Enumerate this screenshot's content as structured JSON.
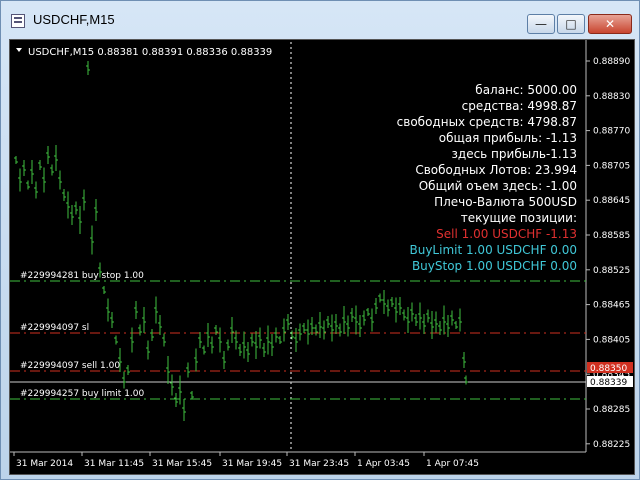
{
  "window": {
    "title": "USDCHF,M15",
    "buttons": {
      "minimize": "—",
      "maximize": "□",
      "close": "✕"
    }
  },
  "chart": {
    "header_label": "USDCHF,M15  0.88381 0.88391 0.88336 0.88339",
    "price_axis": [
      "0.88890",
      "0.88830",
      "0.88770",
      "0.88705",
      "0.88645",
      "0.88585",
      "0.88525",
      "0.88465",
      "0.88405",
      "0.88345",
      "0.88285",
      "0.88225"
    ],
    "time_axis": [
      "31 Mar 2014",
      "31 Mar 11:45",
      "31 Mar 15:45",
      "31 Mar 19:45",
      "31 Mar 23:45",
      "1 Apr 03:45",
      "1 Apr 07:45"
    ],
    "price_tags": {
      "red": "0.88350",
      "white": "0.88339"
    },
    "order_lines": [
      {
        "label": "#229994281 buy stop 1.00",
        "color": "#3fbf3f"
      },
      {
        "label": "#229994097 sl",
        "color": "#d03020"
      },
      {
        "label": "#229994097 sell 1.00",
        "color": "#d03020"
      },
      {
        "label": "#229994257 buy limit 1.00",
        "color": "#3fbf3f"
      }
    ],
    "info_panel": [
      {
        "text": "баланс: 5000.00",
        "color": "#ffffff"
      },
      {
        "text": "средства: 4998.87",
        "color": "#ffffff"
      },
      {
        "text": "свободных средств: 4798.87",
        "color": "#ffffff"
      },
      {
        "text": "общая прибыль: -1.13",
        "color": "#ffffff"
      },
      {
        "text": "здесь прибыль-1.13",
        "color": "#ffffff"
      },
      {
        "text": "Свободных Лотов: 23.994",
        "color": "#ffffff"
      },
      {
        "text": "Общий оъем здесь: -1.00",
        "color": "#ffffff"
      },
      {
        "text": "Плечо-Валюта 500USD",
        "color": "#ffffff"
      },
      {
        "text": "текущие позиции:",
        "color": "#ffffff"
      },
      {
        "text": "Sell 1.00 USDCHF -1.13",
        "color": "#e03030"
      },
      {
        "text": "BuyLimit 1.00 USDCHF 0.00",
        "color": "#40c8d8"
      },
      {
        "text": "BuyStop 1.00 USDCHF 0.00",
        "color": "#40c8d8"
      }
    ]
  },
  "colors": {
    "background": "#000000",
    "bars": "#3fbf3f",
    "text": "#ffffff"
  }
}
